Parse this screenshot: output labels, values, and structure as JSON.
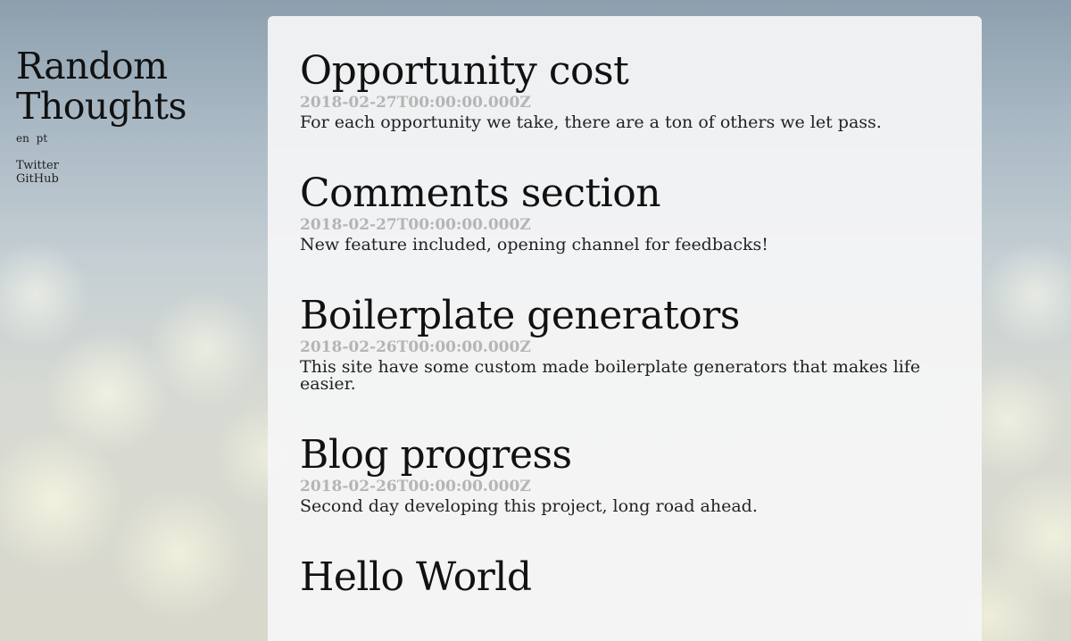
{
  "site": {
    "title_line1": "Random",
    "title_line2": "Thoughts",
    "languages": [
      "en",
      "pt"
    ],
    "social": [
      "Twitter",
      "GitHub"
    ]
  },
  "posts": [
    {
      "title": "Opportunity cost",
      "date": "2018-02-27T00:00:00.000Z",
      "summary": "For each opportunity we take, there are a ton of others we let pass."
    },
    {
      "title": "Comments section",
      "date": "2018-02-27T00:00:00.000Z",
      "summary": "New feature included, opening channel for feedbacks!"
    },
    {
      "title": "Boilerplate generators",
      "date": "2018-02-26T00:00:00.000Z",
      "summary": "This site have some custom made boilerplate generators that makes life easier."
    },
    {
      "title": "Blog progress",
      "date": "2018-02-26T00:00:00.000Z",
      "summary": "Second day developing this project, long road ahead."
    },
    {
      "title": "Hello World",
      "date": "",
      "summary": ""
    }
  ]
}
